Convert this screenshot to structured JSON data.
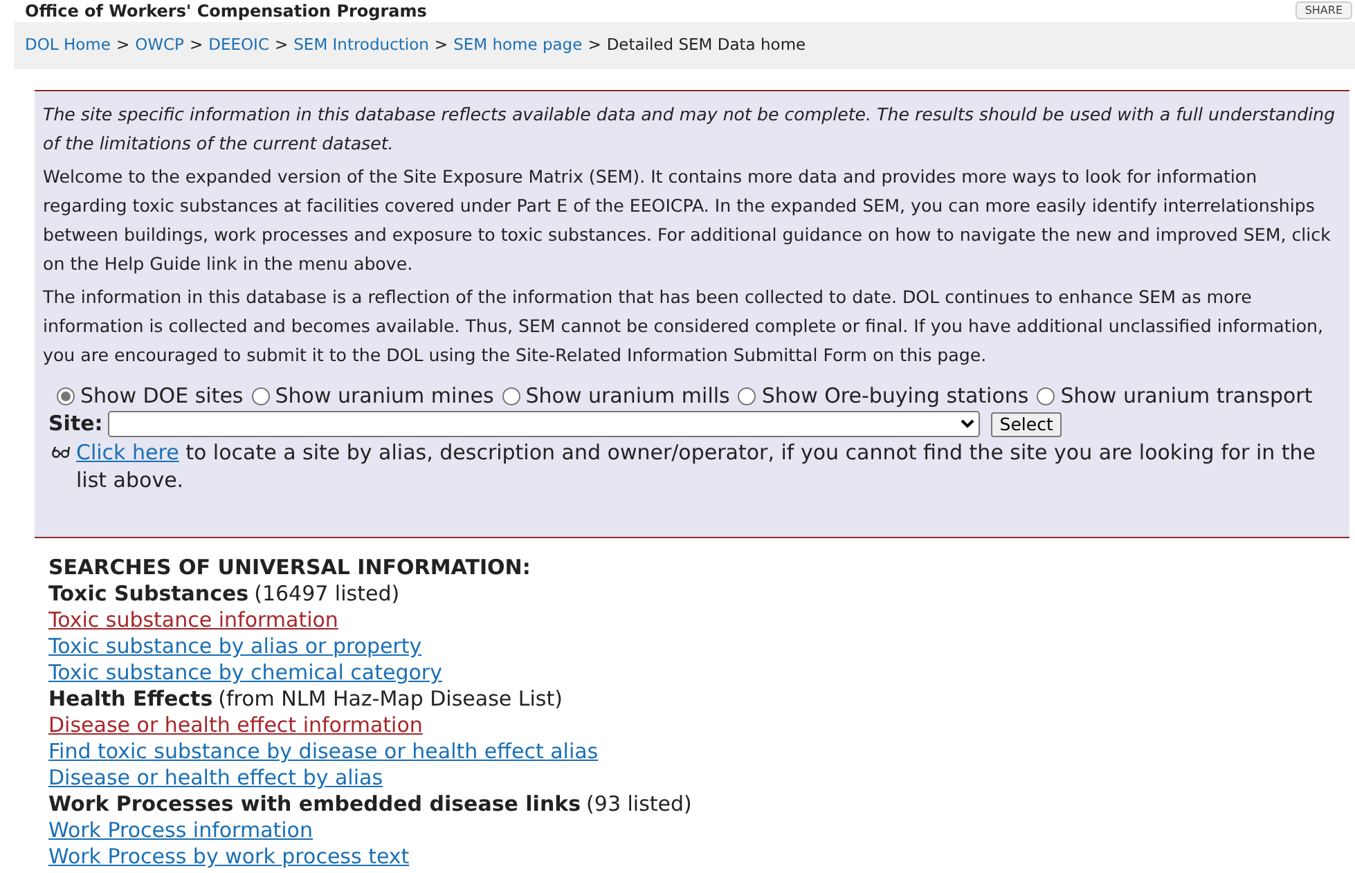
{
  "header": {
    "title": "Office of Workers' Compensation Programs",
    "share_button": "SHARE"
  },
  "breadcrumb": {
    "links": [
      "DOL Home",
      "OWCP",
      "DEEOIC",
      "SEM Introduction",
      "SEM home page"
    ],
    "separator": ">",
    "current": "Detailed SEM Data home"
  },
  "info_panel": {
    "disclaimer": "The site specific information in this database reflects available data and may not be complete. The results should be used with a full understanding of the limitations of the current dataset.",
    "paragraphs": [
      "Welcome to the expanded version of the Site Exposure Matrix (SEM). It contains more data and provides more ways to look for information regarding toxic substances at facilities covered under Part E of the EEOICPA. In the expanded SEM, you can more easily identify interrelationships between buildings, work processes and exposure to toxic substances. For additional guidance on how to navigate the new and improved SEM, click on the Help Guide link in the menu above.",
      "The information in this database is a reflection of the information that has been collected to date. DOL continues to enhance SEM as more information is collected and becomes available. Thus, SEM cannot be considered complete or final. If you have additional unclassified information, you are encouraged to submit it to the DOL using the Site-Related Information Submittal Form on this page."
    ],
    "site_types": [
      {
        "label": "Show DOE sites",
        "selected": true
      },
      {
        "label": "Show uranium mines",
        "selected": false
      },
      {
        "label": "Show uranium mills",
        "selected": false
      },
      {
        "label": "Show Ore-buying stations",
        "selected": false
      },
      {
        "label": "Show uranium transport",
        "selected": false
      }
    ],
    "site_label": "Site:",
    "select_button": "Select",
    "locate_link": "Click here",
    "locate_text": "to locate a site by alias, description and owner/operator, if you cannot find the site you are looking for in the list above."
  },
  "searches": {
    "heading": "SEARCHES OF UNIVERSAL INFORMATION:",
    "items": [
      {
        "kind": "heading",
        "title": "Toxic Substances",
        "note": "(16497 listed)"
      },
      {
        "kind": "link",
        "label": "Toxic substance information",
        "visited": true
      },
      {
        "kind": "link",
        "label": "Toxic substance by alias or property",
        "visited": false
      },
      {
        "kind": "link",
        "label": "Toxic substance by chemical category",
        "visited": false
      },
      {
        "kind": "heading",
        "title": "Health Effects",
        "note": "(from NLM Haz-Map Disease List)"
      },
      {
        "kind": "link",
        "label": "Disease or health effect information",
        "visited": true
      },
      {
        "kind": "link",
        "label": "Find toxic substance by disease or health effect alias",
        "visited": false
      },
      {
        "kind": "link",
        "label": "Disease or health effect by alias",
        "visited": false
      },
      {
        "kind": "heading",
        "title": "Work Processes with embedded disease links",
        "note": "(93 listed)"
      },
      {
        "kind": "link",
        "label": "Work Process information",
        "visited": false
      },
      {
        "kind": "link",
        "label": "Work Process by work process text",
        "visited": false
      }
    ]
  }
}
